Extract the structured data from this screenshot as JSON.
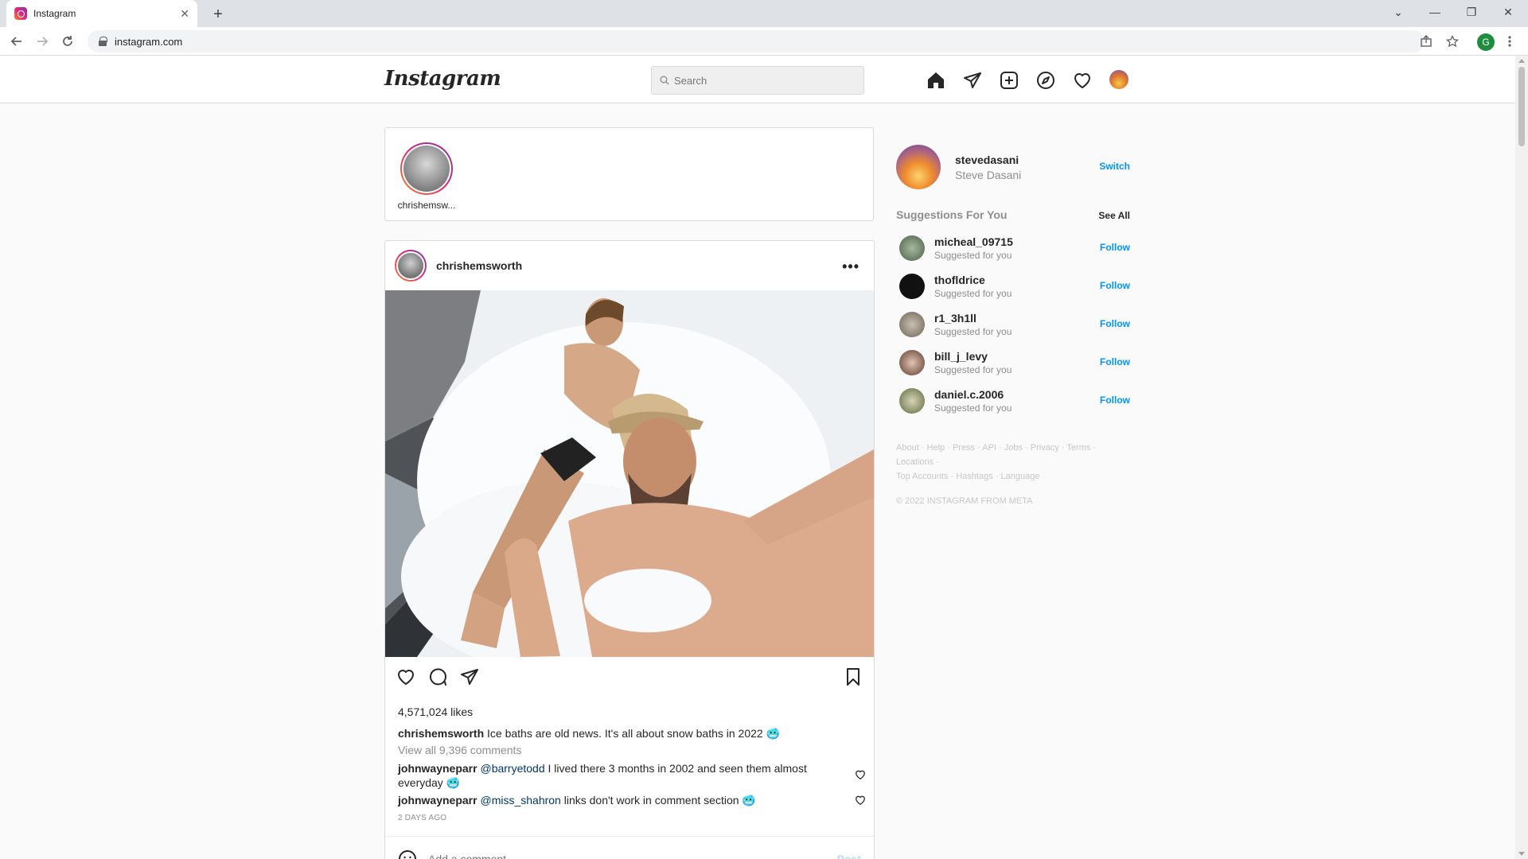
{
  "browser": {
    "tab_title": "Instagram",
    "tab_close": "✕",
    "new_tab": "+",
    "url": "instagram.com",
    "profile_initial": "G",
    "window_controls": [
      "⌄",
      "—",
      "❐",
      "✕"
    ]
  },
  "header": {
    "logo": "Instagram",
    "search_placeholder": "Search"
  },
  "stories": [
    {
      "username": "chrishemsw..."
    }
  ],
  "post": {
    "username": "chrishemsworth",
    "more": "•••",
    "likes": "4,571,024 likes",
    "caption_user": "chrishemsworth",
    "caption_text": "Ice baths are old news. It's all about snow baths in 2022 🥶",
    "view_all_comments": "View all 9,396 comments",
    "comments": [
      {
        "user": "johnwayneparr",
        "mention": "@barryetodd",
        "text": "I lived there 3 months in 2002 and seen them almost everyday 🥶"
      },
      {
        "user": "johnwayneparr",
        "mention": "@miss_shahron",
        "text": "links don't work in comment section 🥶"
      }
    ],
    "time_ago": "2 DAYS AGO",
    "add_comment_placeholder": "Add a comment...",
    "post_button": "Post"
  },
  "sidebar": {
    "me": {
      "username": "stevedasani",
      "name": "Steve Dasani",
      "switch_label": "Switch"
    },
    "suggestions_title": "Suggestions For You",
    "see_all": "See All",
    "suggestions": [
      {
        "username": "micheal_09715",
        "subtitle": "Suggested for you",
        "action": "Follow"
      },
      {
        "username": "thofldrice",
        "subtitle": "Suggested for you",
        "action": "Follow"
      },
      {
        "username": "r1_3h1ll",
        "subtitle": "Suggested for you",
        "action": "Follow"
      },
      {
        "username": "bill_j_levy",
        "subtitle": "Suggested for you",
        "action": "Follow"
      },
      {
        "username": "daniel.c.2006",
        "subtitle": "Suggested for you",
        "action": "Follow"
      }
    ],
    "footer_links": [
      "About",
      "Help",
      "Press",
      "API",
      "Jobs",
      "Privacy",
      "Terms",
      "Locations",
      "Top Accounts",
      "Hashtags",
      "Language"
    ],
    "copyright": "© 2022 INSTAGRAM FROM META"
  },
  "colors": {
    "accent": "#0095f6",
    "text": "#262626",
    "muted": "#8e8e8e",
    "border": "#dbdbdb",
    "background": "#fafafa"
  },
  "icons": {
    "header_nav": [
      "home-icon",
      "direct-icon",
      "new-post-icon",
      "explore-icon",
      "activity-icon",
      "profile-avatar"
    ],
    "post_actions": [
      "like-icon",
      "comment-icon",
      "share-icon",
      "save-icon"
    ]
  }
}
